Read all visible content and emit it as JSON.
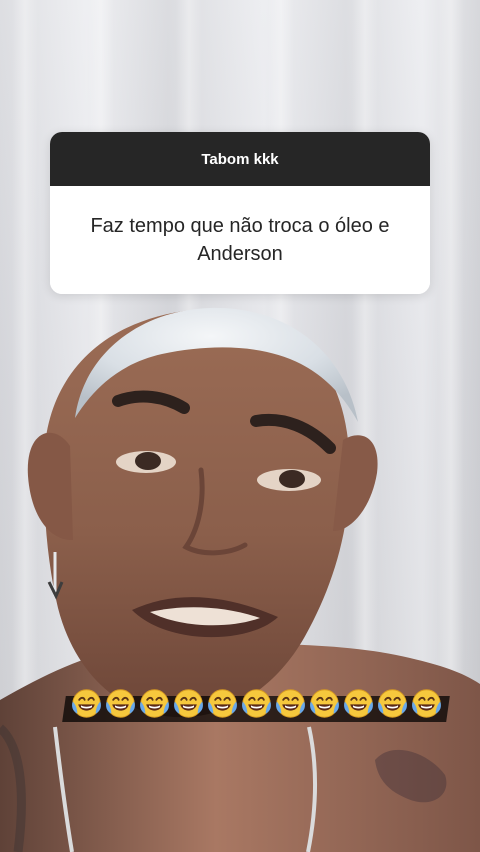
{
  "question_sticker": {
    "header": "Tabom kkk",
    "text": "Faz tempo que não troca o óleo e Anderson"
  },
  "emoji_row": {
    "emoji_icon": "face-with-tears-of-joy-icon",
    "count": 11
  },
  "colors": {
    "sticker_header_bg": "#262626",
    "sticker_body_bg": "#ffffff",
    "sticker_text": "#262626",
    "emoji_yellow": "#f6c83d",
    "emoji_tears": "#69a8e9"
  }
}
